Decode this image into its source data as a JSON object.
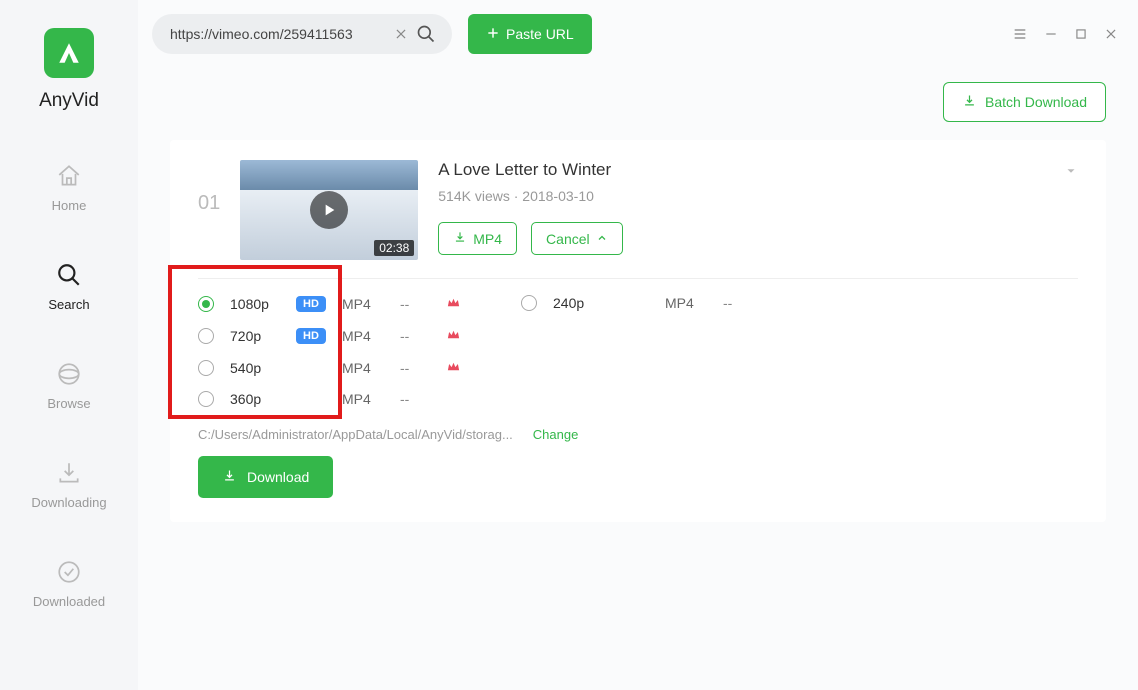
{
  "app": {
    "name": "AnyVid"
  },
  "sidebar": {
    "items": [
      {
        "label": "Home"
      },
      {
        "label": "Search"
      },
      {
        "label": "Browse"
      },
      {
        "label": "Downloading"
      },
      {
        "label": "Downloaded"
      }
    ]
  },
  "topbar": {
    "search_value": "https://vimeo.com/259411563",
    "paste_label": "Paste URL"
  },
  "batch": {
    "label": "Batch Download"
  },
  "result": {
    "index": "01",
    "duration": "02:38",
    "title": "A Love Letter to Winter",
    "subtitle": "514K views · 2018-03-10",
    "mp4_label": "MP4",
    "cancel_label": "Cancel",
    "quality_left": [
      {
        "label": "1080p",
        "hd": true,
        "format": "MP4",
        "size": "--",
        "premium": true,
        "selected": true
      },
      {
        "label": "720p",
        "hd": true,
        "format": "MP4",
        "size": "--",
        "premium": true,
        "selected": false
      },
      {
        "label": "540p",
        "hd": false,
        "format": "MP4",
        "size": "--",
        "premium": true,
        "selected": false
      },
      {
        "label": "360p",
        "hd": false,
        "format": "MP4",
        "size": "--",
        "premium": false,
        "selected": false
      }
    ],
    "quality_right": [
      {
        "label": "240p",
        "hd": false,
        "format": "MP4",
        "size": "--",
        "premium": false,
        "selected": false
      }
    ],
    "path": "C:/Users/Administrator/AppData/Local/AnyVid/storag...",
    "change_label": "Change",
    "download_label": "Download"
  }
}
